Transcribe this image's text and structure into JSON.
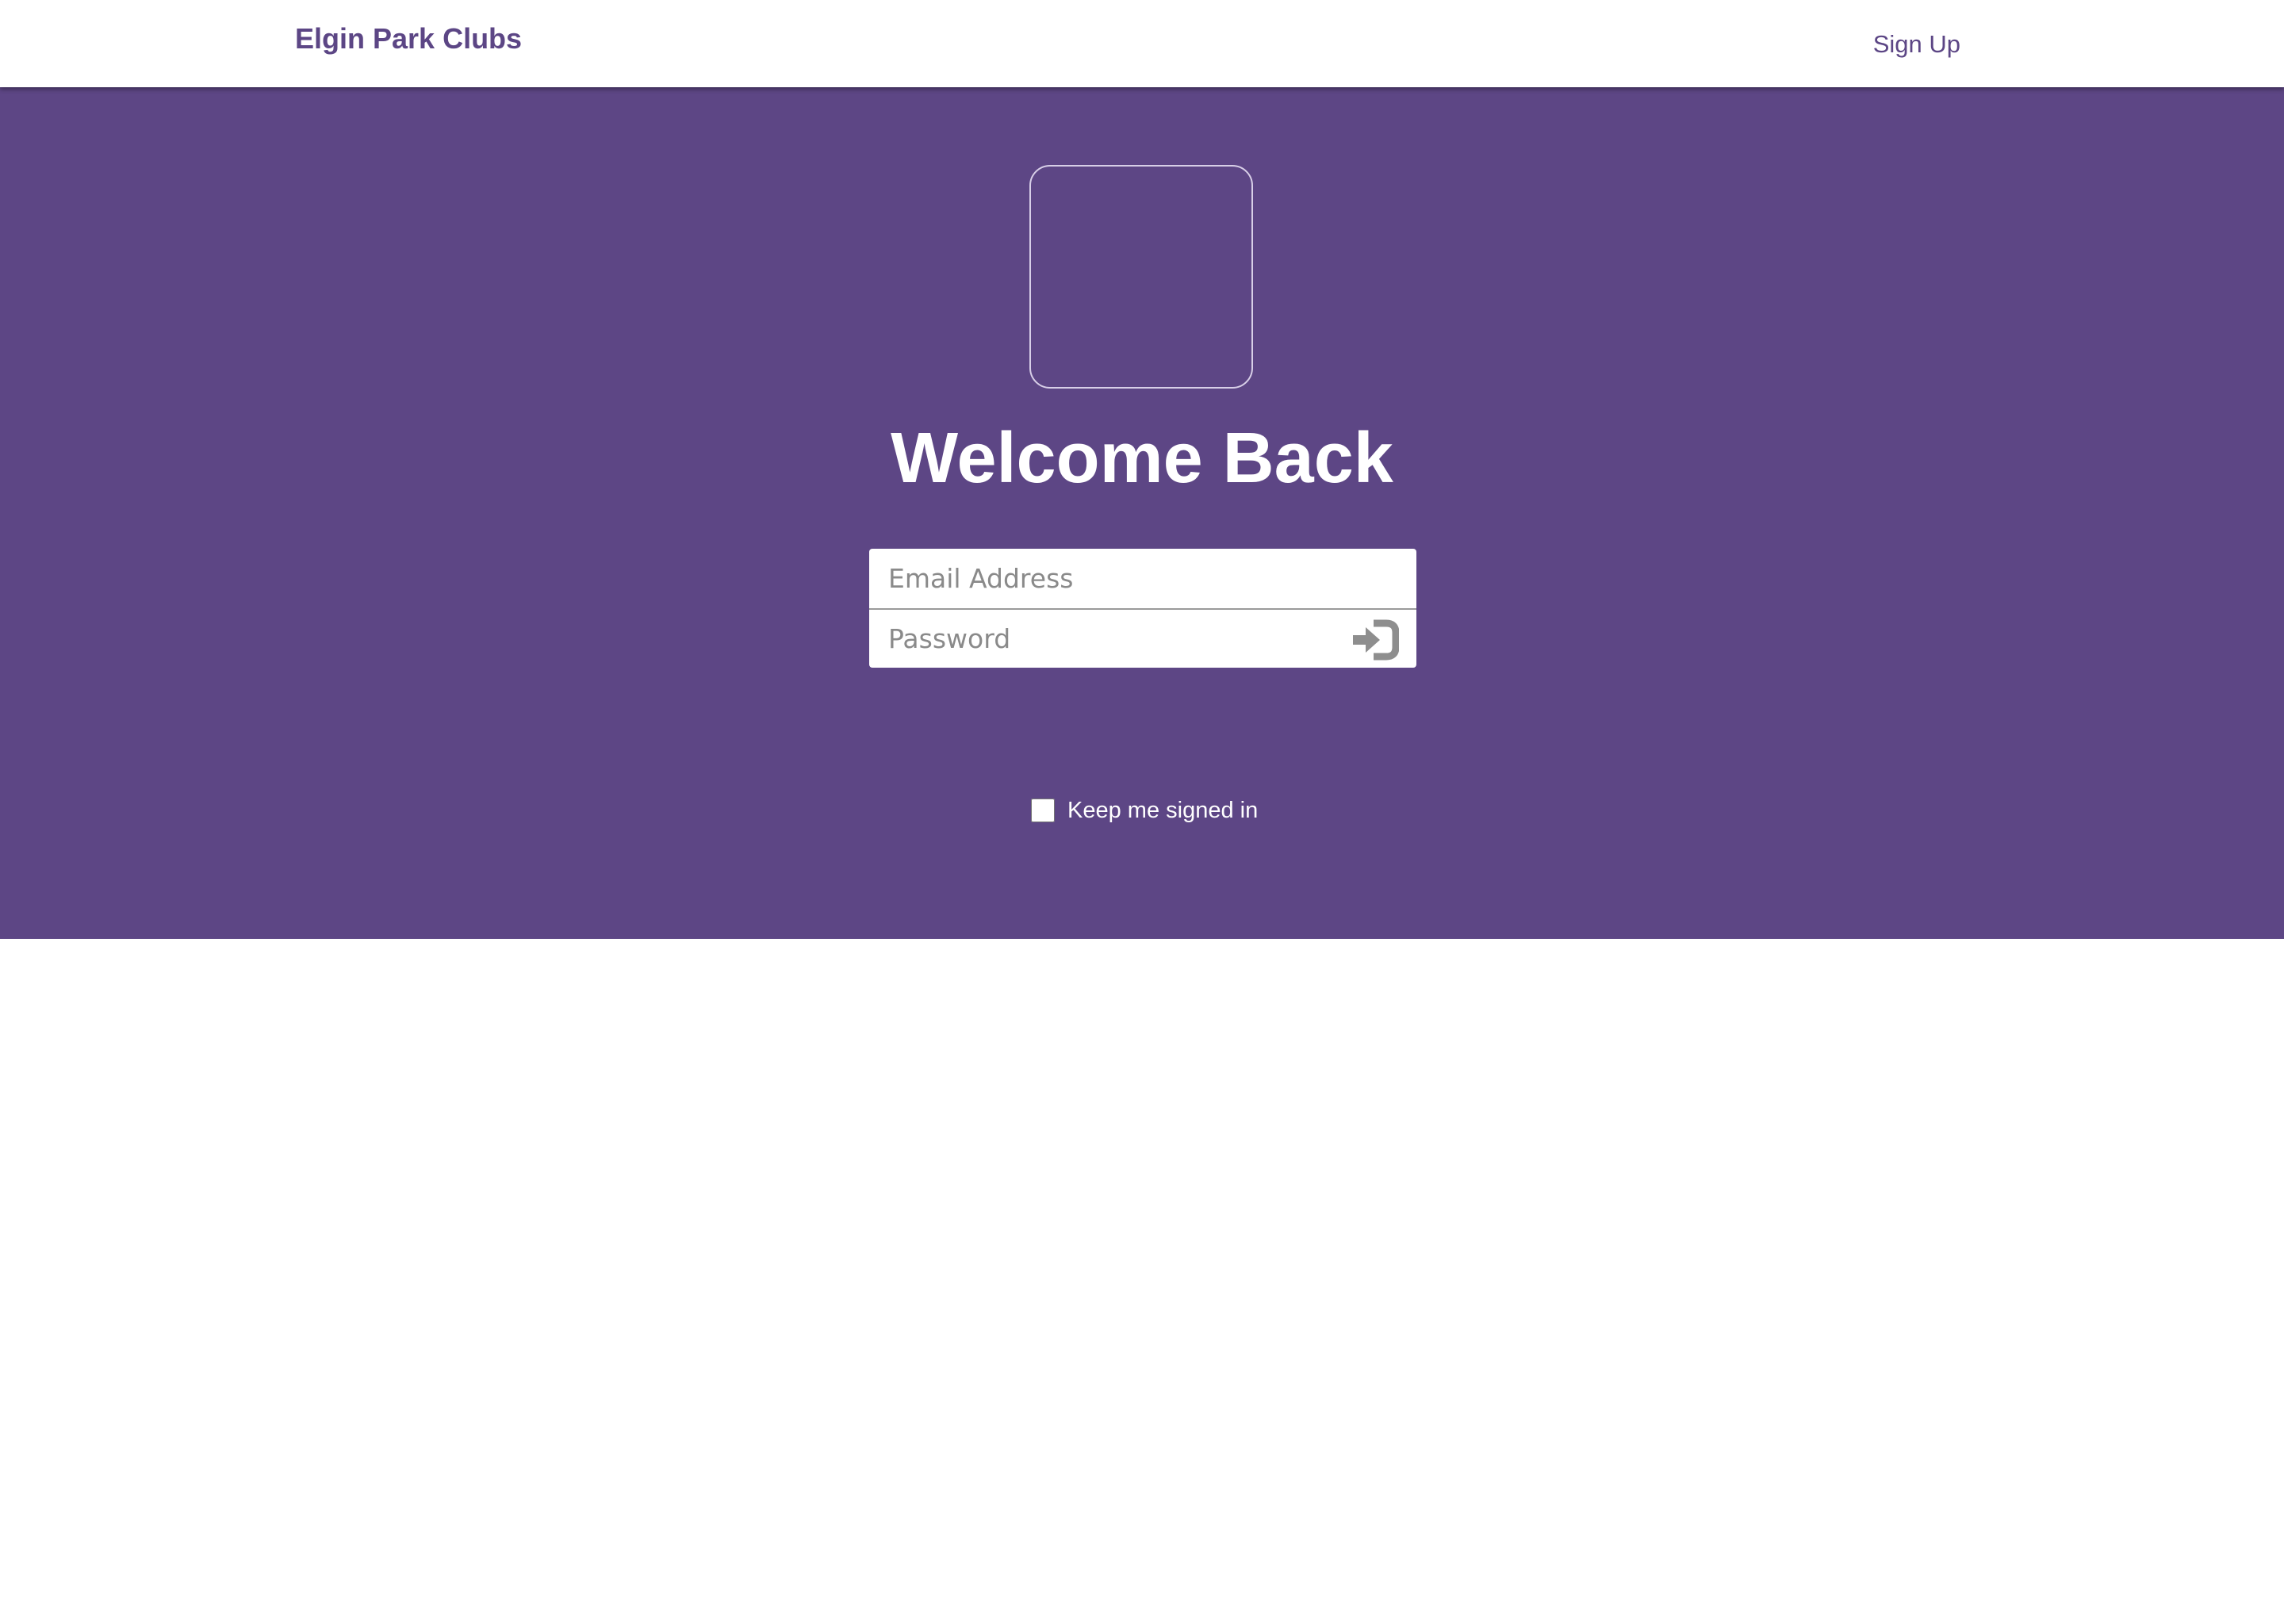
{
  "navbar": {
    "brand": "Elgin Park Clubs",
    "signup_label": "Sign Up"
  },
  "hero": {
    "title": "Welcome Back",
    "background_color": "#5d4685"
  },
  "login_form": {
    "email_placeholder": "Email Address",
    "email_value": "",
    "password_placeholder": "Password",
    "password_value": "",
    "submit_icon": "sign-in-icon"
  },
  "remember": {
    "label": "Keep me signed in",
    "checked": false
  },
  "colors": {
    "brand": "#5c4685",
    "accent": "#5d4685"
  }
}
